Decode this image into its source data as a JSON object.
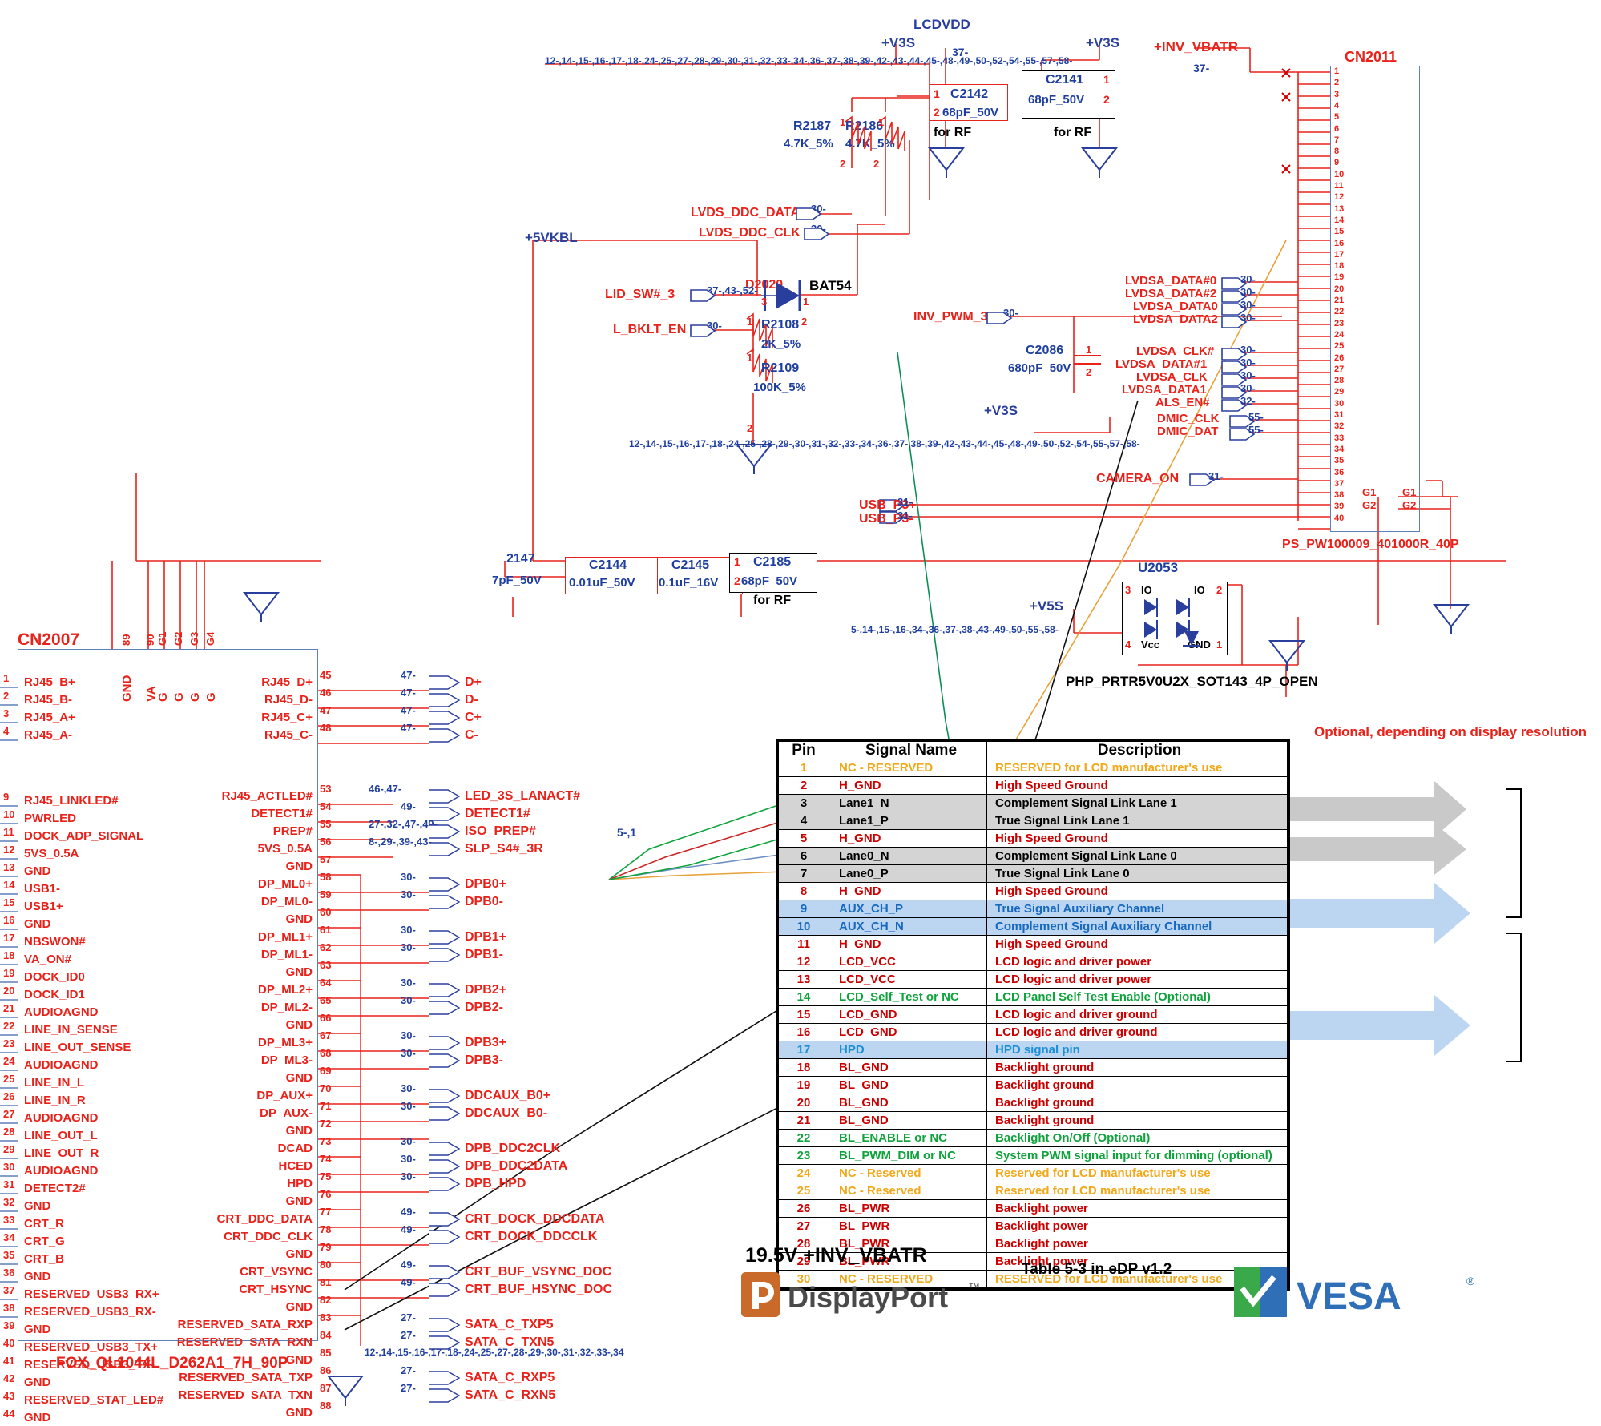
{
  "title": "eDP / LVDS interface schematic",
  "nets": {
    "lcdvdd": "LCDVDD",
    "v3s_a": "+V3S",
    "v3s_b": "+V3S",
    "v3s_c": "+V3S",
    "v5s": "+V5S",
    "v5vkbl": "+5VKBL",
    "inv_vbatr": "+INV_VBATR",
    "pin37_tag": "37-",
    "pin37b_tag": "37-"
  },
  "top_bus_label": "12-,14-,15-,16-,17-,18-,24-,25-,27-,28-,29-,30-,31-,32-,33-,34-,36-,37-,38-,39-,42-,43-,44-,45-,48-,49-,50-,52-,54-,55-,57-,58-",
  "mid_bus_label": "12-,14-,15-,16-,17-,18-,24-,25-,28-,29-,30-,31-,32-,33-,34-,36-,37-,38-,39-,42-,43-,44-,45-,48-,49-,50-,52-,54-,55-,57-,58-",
  "v5s_bus_label": "5-,14-,15-,16-,34-,36-,37-,38-,43-,49-,50-,55-,58-",
  "bottom_bus_label": "12-,14-,15-,16-,17-,18-,24-,25-,27-,28-,29-,30-,31-,32-,33-,34",
  "resistors": [
    {
      "ref": "R2187",
      "value": "4.7K_5%"
    },
    {
      "ref": "R2186",
      "value": "4.7K_5%"
    },
    {
      "ref": "R2108",
      "value": "2K_5%"
    },
    {
      "ref": "R2109",
      "value": "100K_5%"
    }
  ],
  "capacitors": [
    {
      "ref": "C2142",
      "value": "68pF_50V",
      "note": "for RF"
    },
    {
      "ref": "C2141",
      "value": "68pF_50V",
      "note": "for RF"
    },
    {
      "ref": "C2086",
      "value": "680pF_50V",
      "note": ""
    },
    {
      "ref": "C2144",
      "value": "0.01uF_50V",
      "note": ""
    },
    {
      "ref": "C2145",
      "value": "0.1uF_16V",
      "note": ""
    },
    {
      "ref": "C2185",
      "value": "68pF_50V",
      "note": "for RF"
    },
    {
      "ref": "2147",
      "value": "7pF_50V",
      "note": ""
    }
  ],
  "diodes": [
    {
      "ref": "D2020",
      "part": "BAT54"
    }
  ],
  "ics": [
    {
      "ref": "U2053",
      "part": "PHP_PRTR5V0U2X_SOT143_4P_OPEN",
      "pins": [
        "3",
        "IO",
        "IO",
        "2",
        "4",
        "Vcc",
        "GND",
        "1"
      ]
    }
  ],
  "signal_labels_left": [
    {
      "name": "LVDS_DDC_DATA",
      "tag": "30-"
    },
    {
      "name": "LVDS_DDC_CLK",
      "tag": "30-"
    },
    {
      "name": "LID_SW#_3",
      "tag": "37-,43-,52-"
    },
    {
      "name": "L_BKLT_EN",
      "tag": "30-"
    },
    {
      "name": "INV_PWM_3",
      "tag": "30-"
    }
  ],
  "signal_labels_right": [
    {
      "name": "LVDSA_DATA#0",
      "tag": "30-"
    },
    {
      "name": "LVDSA_DATA#2",
      "tag": "30-"
    },
    {
      "name": "LVDSA_DATA0",
      "tag": "30-"
    },
    {
      "name": "LVDSA_DATA2",
      "tag": "30-"
    },
    {
      "name": "LVDSA_CLK#",
      "tag": "30-"
    },
    {
      "name": "LVDSA_DATA#1",
      "tag": "30-"
    },
    {
      "name": "LVDSA_CLK",
      "tag": "30-"
    },
    {
      "name": "LVDSA_DATA1",
      "tag": "30-"
    },
    {
      "name": "ALS_EN#",
      "tag": "32-"
    },
    {
      "name": "DMIC_CLK",
      "tag": "55-"
    },
    {
      "name": "DMIC_DAT",
      "tag": "55-"
    },
    {
      "name": "CAMERA_ON",
      "tag": "31-"
    },
    {
      "name": "USB_P3+",
      "tag": "31-"
    },
    {
      "name": "USB_P3-",
      "tag": "31-"
    }
  ],
  "cn2011": {
    "ref": "CN2011",
    "part": "PS_PW100009_401000R_40P",
    "pin_count": 40,
    "gnd_pins": [
      "G1",
      "G2"
    ],
    "gnd_pins_right": [
      "G1",
      "G2"
    ]
  },
  "cn2007": {
    "ref": "CN2007",
    "part": "FOX_QL1044L_D262A1_7H_90P",
    "top_pins": [
      {
        "num": "89",
        "name": "GND"
      },
      {
        "num": "90",
        "name": "VA"
      },
      {
        "num": "G1",
        "name": "G"
      },
      {
        "num": "G2",
        "name": "G"
      },
      {
        "num": "G3",
        "name": "G"
      },
      {
        "num": "G4",
        "name": "G"
      }
    ],
    "left_pins": [
      {
        "num": "1",
        "name": "RJ45_B+"
      },
      {
        "num": "2",
        "name": "RJ45_B-"
      },
      {
        "num": "3",
        "name": "RJ45_A+"
      },
      {
        "num": "4",
        "name": "RJ45_A-"
      },
      {
        "num": "9",
        "name": "RJ45_LINKLED#"
      },
      {
        "num": "10",
        "name": "PWRLED"
      },
      {
        "num": "11",
        "name": "DOCK_ADP_SIGNAL"
      },
      {
        "num": "12",
        "name": "5VS_0.5A"
      },
      {
        "num": "13",
        "name": "GND"
      },
      {
        "num": "14",
        "name": "USB1-"
      },
      {
        "num": "15",
        "name": "USB1+"
      },
      {
        "num": "16",
        "name": "GND"
      },
      {
        "num": "17",
        "name": "NBSWON#"
      },
      {
        "num": "18",
        "name": "VA_ON#"
      },
      {
        "num": "19",
        "name": "DOCK_ID0"
      },
      {
        "num": "20",
        "name": "DOCK_ID1"
      },
      {
        "num": "21",
        "name": "AUDIOAGND"
      },
      {
        "num": "22",
        "name": "LINE_IN_SENSE"
      },
      {
        "num": "23",
        "name": "LINE_OUT_SENSE"
      },
      {
        "num": "24",
        "name": "AUDIOAGND"
      },
      {
        "num": "25",
        "name": "LINE_IN_L"
      },
      {
        "num": "26",
        "name": "LINE_IN_R"
      },
      {
        "num": "27",
        "name": "AUDIOAGND"
      },
      {
        "num": "28",
        "name": "LINE_OUT_L"
      },
      {
        "num": "29",
        "name": "LINE_OUT_R"
      },
      {
        "num": "30",
        "name": "AUDIOAGND"
      },
      {
        "num": "31",
        "name": "DETECT2#"
      },
      {
        "num": "32",
        "name": "GND"
      },
      {
        "num": "33",
        "name": "CRT_R"
      },
      {
        "num": "34",
        "name": "CRT_G"
      },
      {
        "num": "35",
        "name": "CRT_B"
      },
      {
        "num": "36",
        "name": "GND"
      },
      {
        "num": "37",
        "name": "RESERVED_USB3_RX+"
      },
      {
        "num": "38",
        "name": "RESERVED_USB3_RX-"
      },
      {
        "num": "39",
        "name": "GND"
      },
      {
        "num": "40",
        "name": "RESERVED_USB3_TX+"
      },
      {
        "num": "41",
        "name": "RESERVED_USB3_TX-"
      },
      {
        "num": "42",
        "name": "GND"
      },
      {
        "num": "43",
        "name": "RESERVED_STAT_LED#"
      },
      {
        "num": "44",
        "name": "GND"
      }
    ],
    "right_pins": [
      {
        "num": "45",
        "name": "RJ45_D+",
        "tag": "47-",
        "net": "D+"
      },
      {
        "num": "46",
        "name": "RJ45_D-",
        "tag": "47-",
        "net": "D-"
      },
      {
        "num": "47",
        "name": "RJ45_C+",
        "tag": "47-",
        "net": "C+"
      },
      {
        "num": "48",
        "name": "RJ45_C-",
        "tag": "47-",
        "net": "C-"
      },
      {
        "num": "53",
        "name": "RJ45_ACTLED#",
        "tag": "46-,47-",
        "net": "LED_3S_LANACT#"
      },
      {
        "num": "54",
        "name": "DETECT1#",
        "tag": "49-",
        "net": "DETECT1#"
      },
      {
        "num": "55",
        "name": "PREP#",
        "tag": "27-,32-,47-,49-",
        "net": "ISO_PREP#"
      },
      {
        "num": "56",
        "name": "5VS_0.5A",
        "tag": "8-,29-,39-,43-",
        "net": "SLP_S4#_3R"
      },
      {
        "num": "57",
        "name": "GND",
        "tag": "",
        "net": ""
      },
      {
        "num": "58",
        "name": "DP_ML0+",
        "tag": "30-",
        "net": "DPB0+"
      },
      {
        "num": "59",
        "name": "DP_ML0-",
        "tag": "30-",
        "net": "DPB0-"
      },
      {
        "num": "60",
        "name": "GND",
        "tag": "",
        "net": ""
      },
      {
        "num": "61",
        "name": "DP_ML1+",
        "tag": "30-",
        "net": "DPB1+"
      },
      {
        "num": "62",
        "name": "DP_ML1-",
        "tag": "30-",
        "net": "DPB1-"
      },
      {
        "num": "63",
        "name": "GND",
        "tag": "",
        "net": ""
      },
      {
        "num": "64",
        "name": "DP_ML2+",
        "tag": "30-",
        "net": "DPB2+"
      },
      {
        "num": "65",
        "name": "DP_ML2-",
        "tag": "30-",
        "net": "DPB2-"
      },
      {
        "num": "66",
        "name": "GND",
        "tag": "",
        "net": ""
      },
      {
        "num": "67",
        "name": "DP_ML3+",
        "tag": "30-",
        "net": "DPB3+"
      },
      {
        "num": "68",
        "name": "DP_ML3-",
        "tag": "30-",
        "net": "DPB3-"
      },
      {
        "num": "69",
        "name": "GND",
        "tag": "",
        "net": ""
      },
      {
        "num": "70",
        "name": "DP_AUX+",
        "tag": "30-",
        "net": "DDCAUX_B0+"
      },
      {
        "num": "71",
        "name": "DP_AUX-",
        "tag": "30-",
        "net": "DDCAUX_B0-"
      },
      {
        "num": "72",
        "name": "GND",
        "tag": "",
        "net": ""
      },
      {
        "num": "73",
        "name": "DCAD",
        "tag": "30-",
        "net": "DPB_DDC2CLK"
      },
      {
        "num": "74",
        "name": "HCED",
        "tag": "30-",
        "net": "DPB_DDC2DATA"
      },
      {
        "num": "75",
        "name": "HPD",
        "tag": "30-",
        "net": "DPB_HPD"
      },
      {
        "num": "76",
        "name": "GND",
        "tag": "",
        "net": ""
      },
      {
        "num": "77",
        "name": "CRT_DDC_DATA",
        "tag": "49-",
        "net": "CRT_DOCK_DDCDATA"
      },
      {
        "num": "78",
        "name": "CRT_DDC_CLK",
        "tag": "49-",
        "net": "CRT_DOCK_DDCCLK"
      },
      {
        "num": "79",
        "name": "GND",
        "tag": "",
        "net": ""
      },
      {
        "num": "80",
        "name": "CRT_VSYNC",
        "tag": "49-",
        "net": "CRT_BUF_VSYNC_DOC"
      },
      {
        "num": "81",
        "name": "CRT_HSYNC",
        "tag": "49-",
        "net": "CRT_BUF_HSYNC_DOC"
      },
      {
        "num": "82",
        "name": "GND",
        "tag": "",
        "net": ""
      },
      {
        "num": "83",
        "name": "RESERVED_SATA_RXP",
        "tag": "27-",
        "net": "SATA_C_TXP5"
      },
      {
        "num": "84",
        "name": "RESERVED_SATA_RXN",
        "tag": "27-",
        "net": "SATA_C_TXN5"
      },
      {
        "num": "85",
        "name": "GND",
        "tag": "",
        "net": ""
      },
      {
        "num": "86",
        "name": "RESERVED_SATA_TXP",
        "tag": "27-",
        "net": "SATA_C_RXP5"
      },
      {
        "num": "87",
        "name": "RESERVED_SATA_TXN",
        "tag": "27-",
        "net": "SATA_C_RXN5"
      },
      {
        "num": "88",
        "name": "GND",
        "tag": "",
        "net": ""
      }
    ]
  },
  "pin_table": {
    "headers": [
      "Pin",
      "Signal Name",
      "Description"
    ],
    "caption": "Table 5-3 in eDP v1.2",
    "annotation": "Optional, depending on display resolution",
    "voltage_note": "19.5V +INV_VBATR",
    "rows": [
      {
        "pin": "1",
        "signal": "NC - RESERVED",
        "desc": "RESERVED for LCD manufacturer's use",
        "color": "org",
        "shade": "none"
      },
      {
        "pin": "2",
        "signal": "H_GND",
        "desc": "High Speed Ground",
        "color": "red",
        "shade": "none"
      },
      {
        "pin": "3",
        "signal": "Lane1_N",
        "desc": "Complement Signal Link Lane 1",
        "color": "blk",
        "shade": "shade"
      },
      {
        "pin": "4",
        "signal": "Lane1_P",
        "desc": "True Signal Link Lane 1",
        "color": "blk",
        "shade": "shade"
      },
      {
        "pin": "5",
        "signal": "H_GND",
        "desc": "High Speed Ground",
        "color": "red",
        "shade": "none"
      },
      {
        "pin": "6",
        "signal": "Lane0_N",
        "desc": "Complement Signal Link Lane 0",
        "color": "blk",
        "shade": "shade"
      },
      {
        "pin": "7",
        "signal": "Lane0_P",
        "desc": "True Signal Link Lane 0",
        "color": "blk",
        "shade": "shade"
      },
      {
        "pin": "8",
        "signal": "H_GND",
        "desc": "High Speed Ground",
        "color": "red",
        "shade": "none"
      },
      {
        "pin": "9",
        "signal": "AUX_CH_P",
        "desc": "True Signal Auxiliary Channel",
        "color": "b2",
        "shade": "bluebg"
      },
      {
        "pin": "10",
        "signal": "AUX_CH_N",
        "desc": "Complement Signal Auxiliary Channel",
        "color": "b2",
        "shade": "bluebg"
      },
      {
        "pin": "11",
        "signal": "H_GND",
        "desc": "High Speed Ground",
        "color": "red",
        "shade": "none"
      },
      {
        "pin": "12",
        "signal": "LCD_VCC",
        "desc": "LCD logic and driver power",
        "color": "red",
        "shade": "none"
      },
      {
        "pin": "13",
        "signal": "LCD_VCC",
        "desc": "LCD logic and driver power",
        "color": "red",
        "shade": "none"
      },
      {
        "pin": "14",
        "signal": "LCD_Self_Test or NC",
        "desc": "LCD Panel Self Test Enable (Optional)",
        "color": "grn",
        "shade": "none"
      },
      {
        "pin": "15",
        "signal": "LCD_GND",
        "desc": "LCD logic and driver ground",
        "color": "red",
        "shade": "none"
      },
      {
        "pin": "16",
        "signal": "LCD_GND",
        "desc": "LCD logic and driver ground",
        "color": "red",
        "shade": "none"
      },
      {
        "pin": "17",
        "signal": "HPD",
        "desc": "HPD signal pin",
        "color": "blu",
        "shade": "bluebg"
      },
      {
        "pin": "18",
        "signal": "BL_GND",
        "desc": "Backlight ground",
        "color": "red",
        "shade": "none"
      },
      {
        "pin": "19",
        "signal": "BL_GND",
        "desc": "Backlight ground",
        "color": "red",
        "shade": "none"
      },
      {
        "pin": "20",
        "signal": "BL_GND",
        "desc": "Backlight ground",
        "color": "red",
        "shade": "none"
      },
      {
        "pin": "21",
        "signal": "BL_GND",
        "desc": "Backlight ground",
        "color": "red",
        "shade": "none"
      },
      {
        "pin": "22",
        "signal": "BL_ENABLE or NC",
        "desc": "Backlight On/Off (Optional)",
        "color": "grn",
        "shade": "none"
      },
      {
        "pin": "23",
        "signal": "BL_PWM_DIM or NC",
        "desc": "System PWM signal input for dimming (optional)",
        "color": "grn",
        "shade": "none"
      },
      {
        "pin": "24",
        "signal": "NC - Reserved",
        "desc": "Reserved for LCD manufacturer's use",
        "color": "org",
        "shade": "none"
      },
      {
        "pin": "25",
        "signal": "NC - Reserved",
        "desc": "Reserved for LCD manufacturer's use",
        "color": "org",
        "shade": "none"
      },
      {
        "pin": "26",
        "signal": "BL_PWR",
        "desc": "Backlight power",
        "color": "red",
        "shade": "none"
      },
      {
        "pin": "27",
        "signal": "BL_PWR",
        "desc": "Backlight power",
        "color": "red",
        "shade": "none"
      },
      {
        "pin": "28",
        "signal": "BL_PWR",
        "desc": "Backlight power",
        "color": "red",
        "shade": "none"
      },
      {
        "pin": "29",
        "signal": "BL_PWR",
        "desc": "Backlight power",
        "color": "red",
        "shade": "none"
      },
      {
        "pin": "30",
        "signal": "NC - RESERVED",
        "desc": "RESERVED for LCD manufacturer's use",
        "color": "org",
        "shade": "none"
      }
    ]
  },
  "logos": {
    "displayport": "DisplayPort",
    "displayport_tm": "™",
    "vesa": "VESA",
    "vesa_r": "®"
  },
  "misc": {
    "for_rf": "for RF",
    "bus_5_1": "5-,1",
    "pin_nums_cn2011_left": [
      "1",
      "2",
      "3",
      "4",
      "5",
      "6",
      "7",
      "8",
      "9",
      "10",
      "11",
      "12",
      "13",
      "14",
      "15",
      "16",
      "17",
      "18",
      "19",
      "20",
      "21",
      "22",
      "23",
      "24",
      "25",
      "26",
      "27",
      "28",
      "29",
      "30",
      "31",
      "32",
      "33",
      "34",
      "35",
      "36",
      "37",
      "38",
      "39",
      "40"
    ]
  }
}
